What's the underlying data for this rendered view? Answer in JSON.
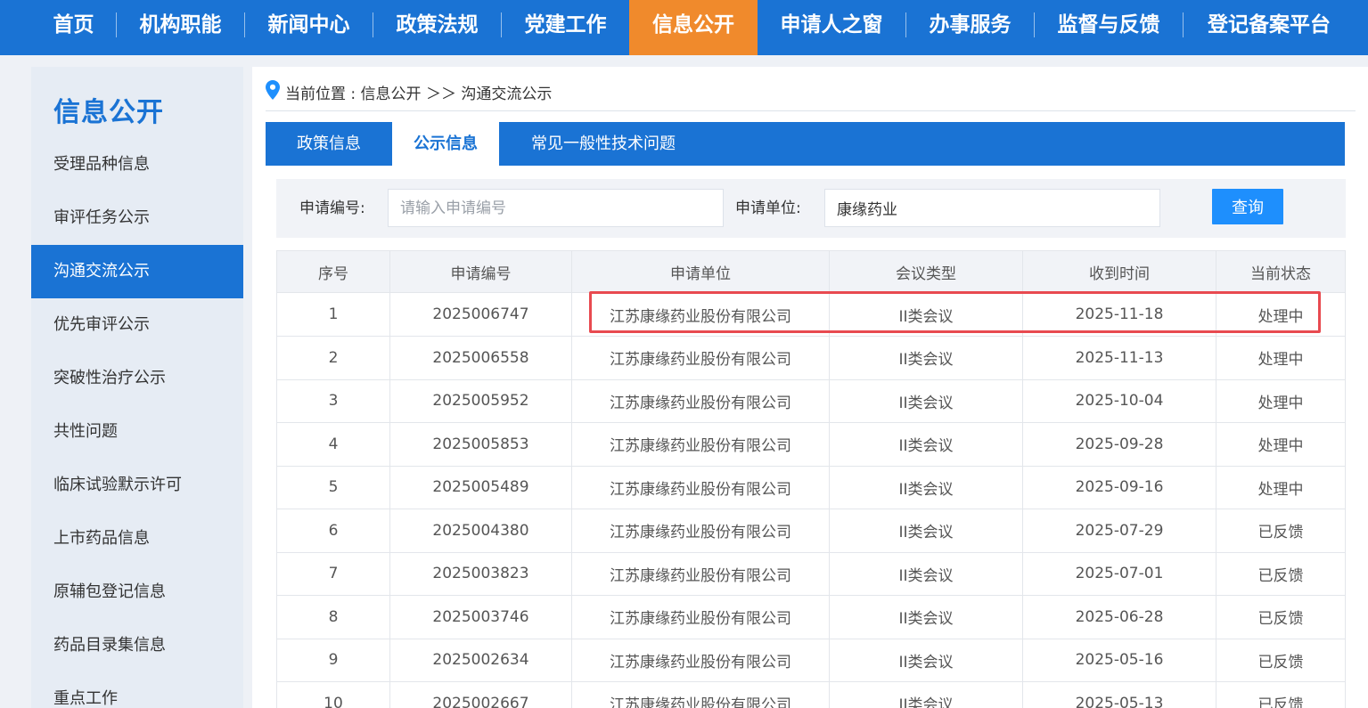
{
  "nav": [
    "首页",
    "机构职能",
    "新闻中心",
    "政策法规",
    "党建工作",
    "信息公开",
    "申请人之窗",
    "办事服务",
    "监督与反馈",
    "登记备案平台"
  ],
  "nav_active_index": 5,
  "sidebar": {
    "title": "信息公开",
    "items": [
      "受理品种信息",
      "审评任务公示",
      "沟通交流公示",
      "优先审评公示",
      "突破性治疗公示",
      "共性问题",
      "临床试验默示许可",
      "上市药品信息",
      "原辅包登记信息",
      "药品目录集信息",
      "重点工作"
    ],
    "active_index": 2
  },
  "breadcrumb": "当前位置 : 信息公开 ＞＞ 沟通交流公示",
  "tabs": [
    "政策信息",
    "公示信息",
    "常见一般性技术问题"
  ],
  "tab_active_index": 1,
  "search": {
    "app_no_label": "申请编号:",
    "app_no_placeholder": "请输入申请编号",
    "app_no_value": "",
    "unit_label": "申请单位:",
    "unit_value": "康缘药业",
    "button": "查询"
  },
  "table": {
    "headers": [
      "序号",
      "申请编号",
      "申请单位",
      "会议类型",
      "收到时间",
      "当前状态"
    ],
    "rows": [
      [
        "1",
        "2025006747",
        "江苏康缘药业股份有限公司",
        "II类会议",
        "2025-11-18",
        "处理中"
      ],
      [
        "2",
        "2025006558",
        "江苏康缘药业股份有限公司",
        "II类会议",
        "2025-11-13",
        "处理中"
      ],
      [
        "3",
        "2025005952",
        "江苏康缘药业股份有限公司",
        "II类会议",
        "2025-10-04",
        "处理中"
      ],
      [
        "4",
        "2025005853",
        "江苏康缘药业股份有限公司",
        "II类会议",
        "2025-09-28",
        "处理中"
      ],
      [
        "5",
        "2025005489",
        "江苏康缘药业股份有限公司",
        "II类会议",
        "2025-09-16",
        "处理中"
      ],
      [
        "6",
        "2025004380",
        "江苏康缘药业股份有限公司",
        "II类会议",
        "2025-07-29",
        "已反馈"
      ],
      [
        "7",
        "2025003823",
        "江苏康缘药业股份有限公司",
        "II类会议",
        "2025-07-01",
        "已反馈"
      ],
      [
        "8",
        "2025003746",
        "江苏康缘药业股份有限公司",
        "II类会议",
        "2025-06-28",
        "已反馈"
      ],
      [
        "9",
        "2025002634",
        "江苏康缘药业股份有限公司",
        "II类会议",
        "2025-05-16",
        "已反馈"
      ],
      [
        "10",
        "2025002667",
        "江苏康缘药业股份有限公司",
        "II类会议",
        "2025-05-13",
        "已反馈"
      ]
    ],
    "highlighted_row_index": 0
  },
  "colors": {
    "primary": "#1a73d4",
    "nav_active": "#f08a2c",
    "button": "#1e8ffd",
    "highlight_border": "#e84a50"
  },
  "icons": {
    "breadcrumb": "location-pin-icon"
  }
}
